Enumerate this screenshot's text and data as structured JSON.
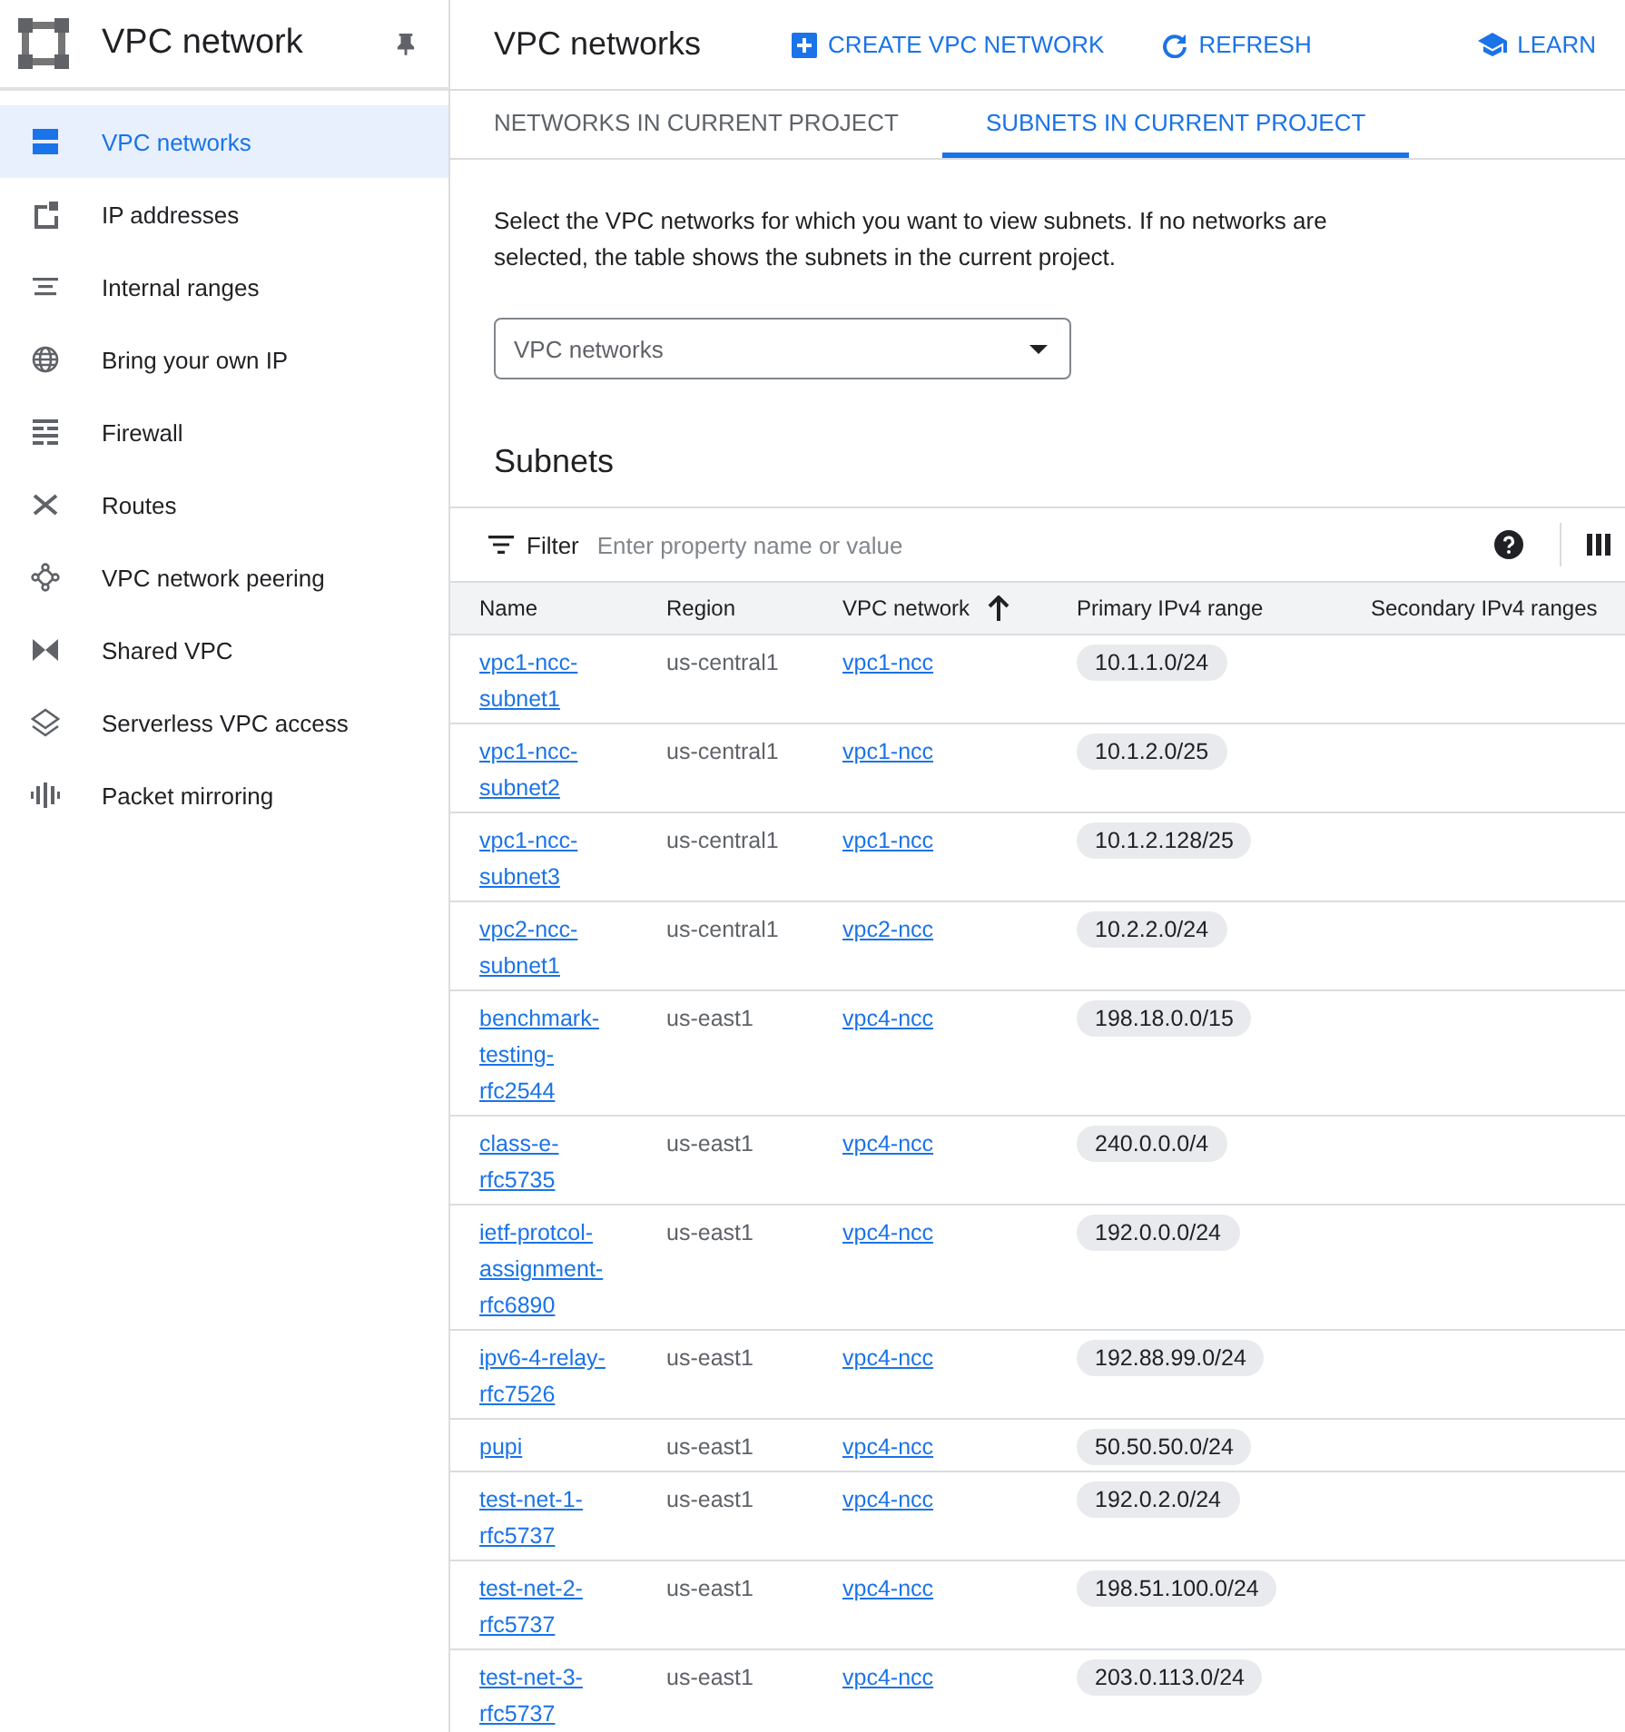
{
  "sidebar": {
    "title": "VPC network",
    "items": [
      {
        "label": "VPC networks",
        "selected": true
      },
      {
        "label": "IP addresses",
        "selected": false
      },
      {
        "label": "Internal ranges",
        "selected": false
      },
      {
        "label": "Bring your own IP",
        "selected": false
      },
      {
        "label": "Firewall",
        "selected": false
      },
      {
        "label": "Routes",
        "selected": false
      },
      {
        "label": "VPC network peering",
        "selected": false
      },
      {
        "label": "Shared VPC",
        "selected": false
      },
      {
        "label": "Serverless VPC access",
        "selected": false
      },
      {
        "label": "Packet mirroring",
        "selected": false
      }
    ]
  },
  "header": {
    "title": "VPC networks",
    "actions": [
      "CREATE VPC NETWORK",
      "REFRESH"
    ],
    "learn": "LEARN"
  },
  "tabs": [
    {
      "label": "NETWORKS IN CURRENT PROJECT",
      "selected": false
    },
    {
      "label": "SUBNETS IN CURRENT PROJECT",
      "selected": true
    }
  ],
  "intro": "Select the VPC networks for which you want to view subnets. If no networks are selected, the table shows the subnets in the current project.",
  "network_select": {
    "placeholder": "VPC networks"
  },
  "section_title": "Subnets",
  "filter": {
    "label": "Filter",
    "placeholder": "Enter property name or value"
  },
  "table": {
    "columns": [
      "Name",
      "Region",
      "VPC network",
      "Primary IPv4 range",
      "Secondary IPv4 ranges"
    ],
    "rows": [
      {
        "name": "vpc1-ncc-subnet1",
        "region": "us-central1",
        "network": "vpc1-ncc",
        "range": "10.1.1.0/24"
      },
      {
        "name": "vpc1-ncc-subnet2",
        "region": "us-central1",
        "network": "vpc1-ncc",
        "range": "10.1.2.0/25"
      },
      {
        "name": "vpc1-ncc-subnet3",
        "region": "us-central1",
        "network": "vpc1-ncc",
        "range": "10.1.2.128/25"
      },
      {
        "name": "vpc2-ncc-subnet1",
        "region": "us-central1",
        "network": "vpc2-ncc",
        "range": "10.2.2.0/24"
      },
      {
        "name": "benchmark-testing-rfc2544",
        "region": "us-east1",
        "network": "vpc4-ncc",
        "range": "198.18.0.0/15"
      },
      {
        "name": "class-e-rfc5735",
        "region": "us-east1",
        "network": "vpc4-ncc",
        "range": "240.0.0.0/4"
      },
      {
        "name": "ietf-protcol-assignment-rfc6890",
        "region": "us-east1",
        "network": "vpc4-ncc",
        "range": "192.0.0.0/24"
      },
      {
        "name": "ipv6-4-relay-rfc7526",
        "region": "us-east1",
        "network": "vpc4-ncc",
        "range": "192.88.99.0/24"
      },
      {
        "name": "pupi",
        "region": "us-east1",
        "network": "vpc4-ncc",
        "range": "50.50.50.0/24"
      },
      {
        "name": "test-net-1-rfc5737",
        "region": "us-east1",
        "network": "vpc4-ncc",
        "range": "192.0.2.0/24"
      },
      {
        "name": "test-net-2-rfc5737",
        "region": "us-east1",
        "network": "vpc4-ncc",
        "range": "198.51.100.0/24"
      },
      {
        "name": "test-net-3-rfc5737",
        "region": "us-east1",
        "network": "vpc4-ncc",
        "range": "203.0.113.0/24"
      }
    ]
  }
}
